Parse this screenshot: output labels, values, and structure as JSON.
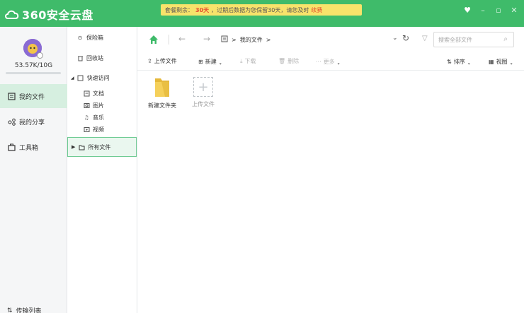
{
  "app": {
    "logo_text": "360安全云盘"
  },
  "notice": {
    "prefix": "套餐剩余：",
    "days": "30天",
    "message": "，过期后数据为您保留30天，请您及时",
    "link": "续费"
  },
  "window_controls": [
    "skin",
    "minimize",
    "maximize",
    "close"
  ],
  "sidebar": {
    "quota": "53.57K/10G",
    "items": [
      {
        "label": "我的文件",
        "icon": "file-icon",
        "active": true
      },
      {
        "label": "我的分享",
        "icon": "share-icon",
        "active": false
      },
      {
        "label": "工具箱",
        "icon": "toolbox-icon",
        "active": false
      }
    ],
    "transfer_label": "传输列表"
  },
  "tree": {
    "items": [
      {
        "label": "保险箱",
        "icon": "safe-icon"
      },
      {
        "label": "回收站",
        "icon": "trash-icon"
      },
      {
        "label": "快速访问",
        "icon": "quick-access-icon"
      },
      {
        "label": "文档",
        "icon": "document-icon"
      },
      {
        "label": "图片",
        "icon": "image-icon"
      },
      {
        "label": "音乐",
        "icon": "music-icon"
      },
      {
        "label": "视频",
        "icon": "video-icon"
      },
      {
        "label": "所有文件",
        "icon": "folder-icon"
      }
    ]
  },
  "navbar": {
    "path_root": "我的文件",
    "path_sep": ">",
    "search_placeholder": "搜索全部文件"
  },
  "toolbar": {
    "upload": "上传文件",
    "new": "新建",
    "download": "下载",
    "delete": "删除",
    "more": "更多",
    "sort": "排序",
    "view": "视图"
  },
  "files": [
    {
      "name": "新建文件夹",
      "type": "folder"
    },
    {
      "name": "上传文件",
      "type": "upload"
    }
  ],
  "colors": {
    "brand_green": "#3fbb6a",
    "notice_bg": "#f8e36b",
    "highlight_red": "#e5482d",
    "active_nav": "#d6efe0"
  }
}
